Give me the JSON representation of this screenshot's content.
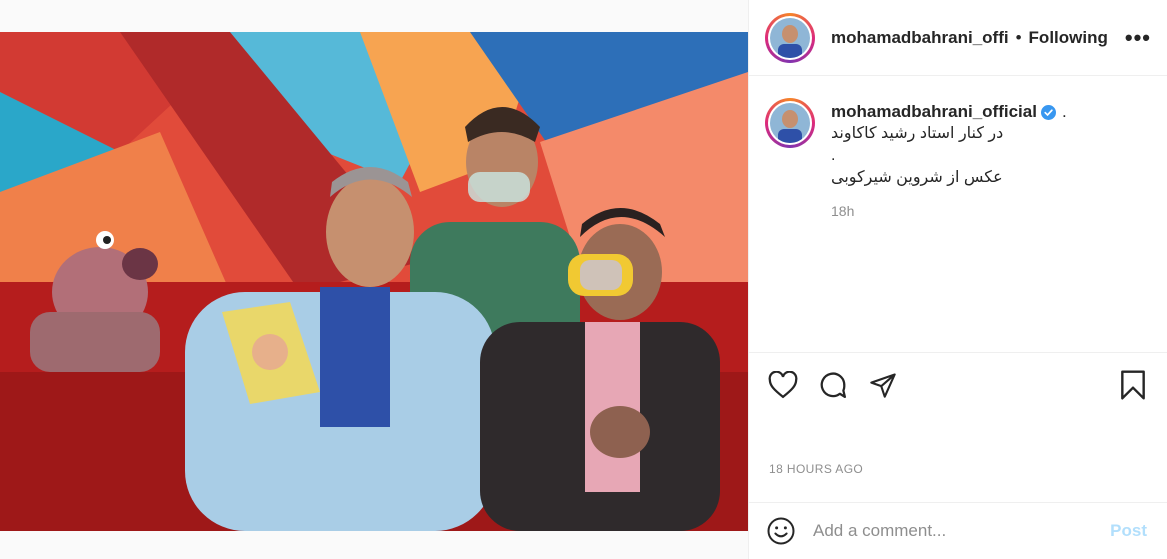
{
  "post": {
    "username_header": "mohamadbahrani_offi",
    "separator": "•",
    "follow_status": "Following",
    "more_label": "•••"
  },
  "caption": {
    "username": "mohamadbahrani_official",
    "trailing": ".",
    "text": "در کنار استاد رشید کاکاوند\n.\nعکس از شروین شیرکوبی",
    "time_ago": "18h"
  },
  "actions": {
    "like": "heart-icon",
    "comment": "comment-bubble-icon",
    "share": "paper-plane-icon",
    "save": "bookmark-icon"
  },
  "timestamp": "18 HOURS AGO",
  "comment_box": {
    "placeholder": "Add a comment...",
    "post_label": "Post"
  },
  "colors": {
    "verified": "#3897f0",
    "post_disabled": "#b2dffc",
    "secondary_text": "#8e8e8e"
  }
}
